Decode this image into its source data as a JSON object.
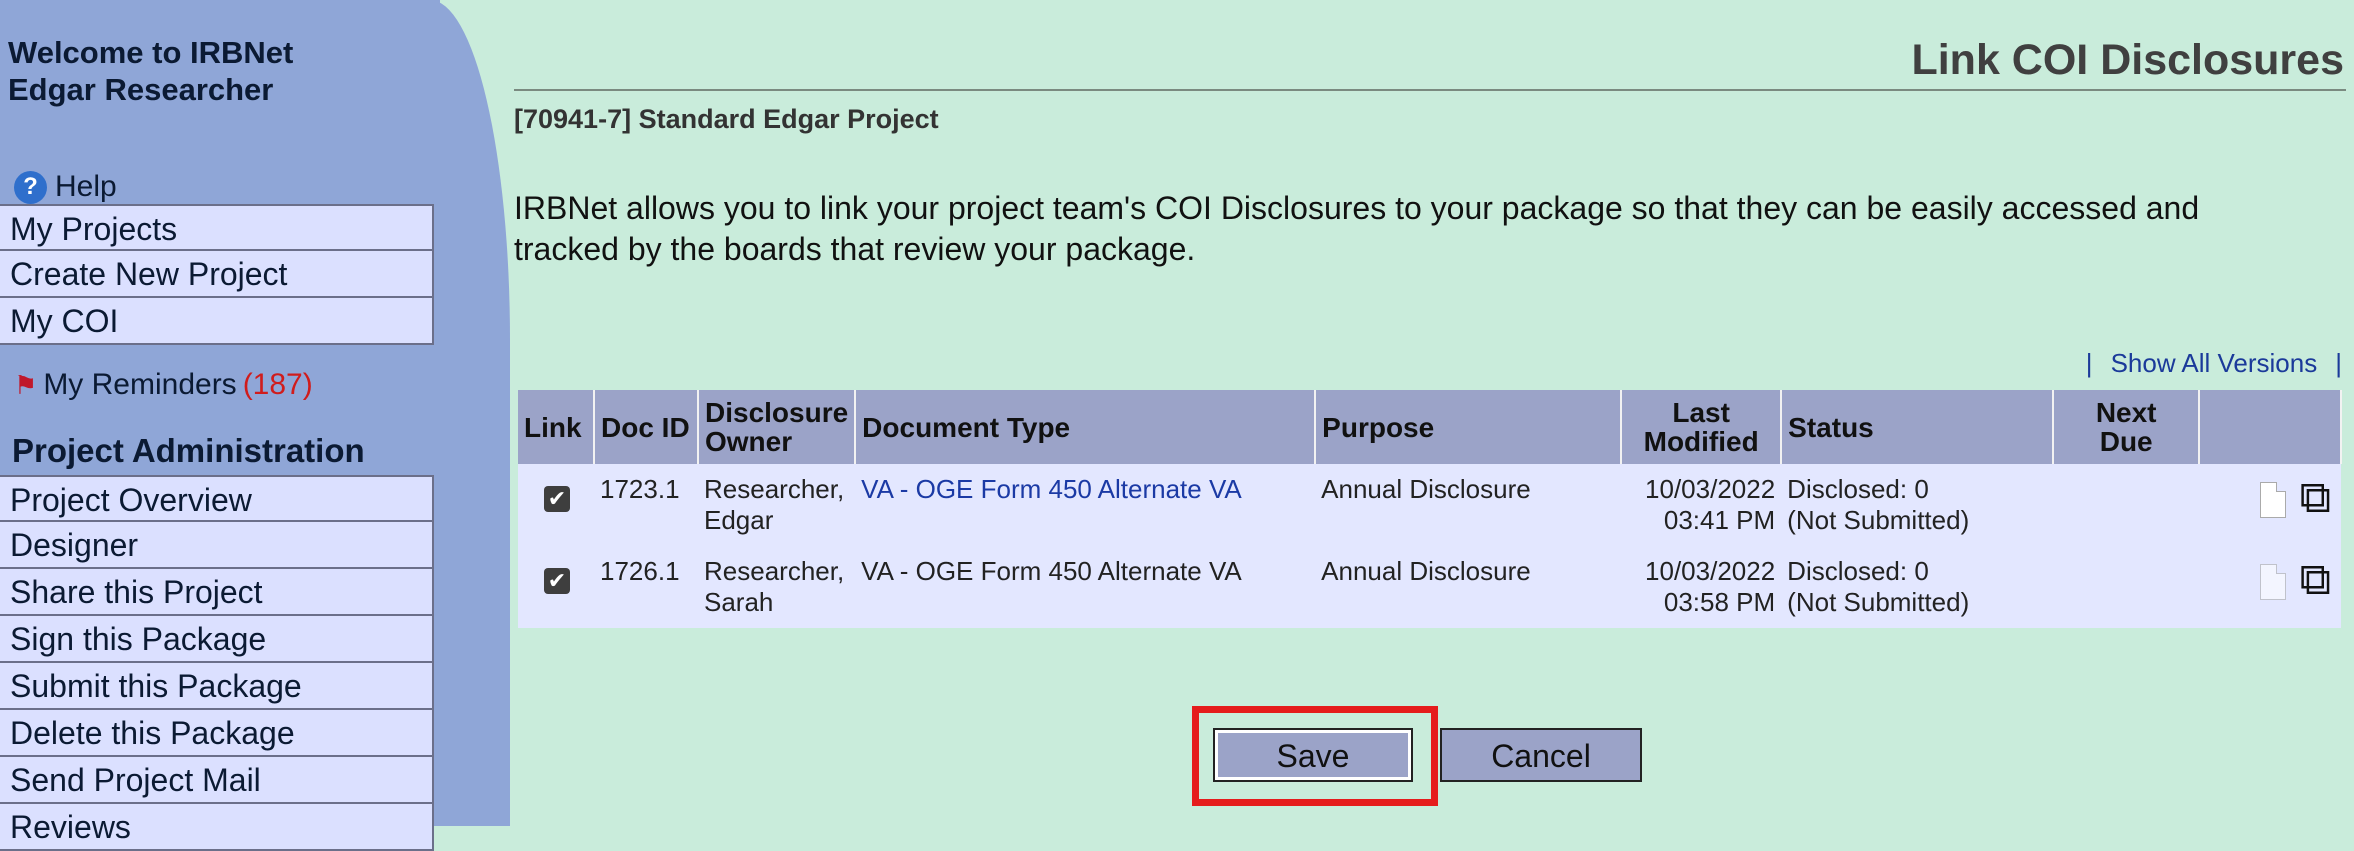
{
  "sidebar": {
    "welcome_line1": "Welcome to IRBNet",
    "welcome_line2": "Edgar Researcher",
    "help_label": "Help",
    "top_items": [
      {
        "label": "My Projects"
      },
      {
        "label": "Create New Project"
      },
      {
        "label": "My COI"
      }
    ],
    "reminders_label": "My Reminders",
    "reminders_count": "(187)",
    "section_title": "Project Administration",
    "admin_items": [
      {
        "label": "Project Overview"
      },
      {
        "label": "Designer"
      },
      {
        "label": "Share this Project"
      },
      {
        "label": "Sign this Package"
      },
      {
        "label": "Submit this Package"
      },
      {
        "label": "Delete this Package"
      },
      {
        "label": "Send Project Mail"
      },
      {
        "label": "Reviews"
      }
    ]
  },
  "main": {
    "page_title": "Link COI Disclosures",
    "project_name": "[70941-7] Standard Edgar Project",
    "intro_text": "IRBNet allows you to link your project team's COI Disclosures to your package so that they can be easily accessed and tracked by the boards that review your package.",
    "versions_sep": "|",
    "show_all_versions": "Show All Versions",
    "table": {
      "headers": {
        "link": "Link",
        "doc_id": "Doc ID",
        "owner_l1": "Disclosure",
        "owner_l2": "Owner",
        "document_type": "Document Type",
        "purpose": "Purpose",
        "modified_l1": "Last",
        "modified_l2": "Modified",
        "status": "Status",
        "next_due_l1": "Next",
        "next_due_l2": "Due"
      },
      "rows": [
        {
          "checked": true,
          "doc_id": "1723.1",
          "owner_l1": "Researcher,",
          "owner_l2": "Edgar",
          "document_type": "VA - OGE Form 450 Alternate VA",
          "purpose": "Annual Disclosure",
          "modified_date": "10/03/2022",
          "modified_time": "03:41 PM",
          "status_l1": "Disclosed: 0",
          "status_l2": "(Not Submitted)",
          "next_due": ""
        },
        {
          "checked": true,
          "doc_id": "1726.1",
          "owner_l1": "Researcher,",
          "owner_l2": "Sarah",
          "document_type": "VA - OGE Form 450 Alternate VA",
          "purpose": "Annual Disclosure",
          "modified_date": "10/03/2022",
          "modified_time": "03:58 PM",
          "status_l1": "Disclosed: 0",
          "status_l2": "(Not Submitted)",
          "next_due": ""
        }
      ]
    },
    "buttons": {
      "save": "Save",
      "cancel": "Cancel"
    }
  },
  "icons": {
    "help": "help-circle-icon",
    "flag": "flag-icon",
    "checkbox": "checkbox-checked-icon",
    "document": "document-icon",
    "copy": "copy-pages-icon"
  },
  "colors": {
    "sidebar_bg": "#8fa6d7",
    "main_bg": "#c9ecdb",
    "nav_item_bg": "#dbe0ff",
    "table_header_bg": "#9ba3c8",
    "table_row_bg": "#e3e7ff",
    "link_color": "#1b3aa5",
    "highlight_border": "#e51c1c",
    "reminder_count": "#d01c1c"
  }
}
